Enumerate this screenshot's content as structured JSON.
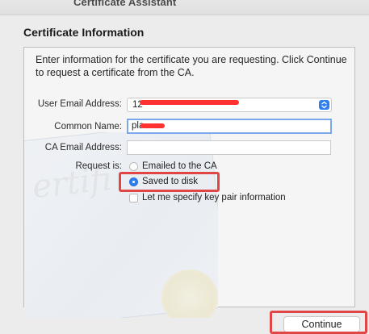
{
  "window": {
    "title": "Certificate Assistant"
  },
  "section": {
    "title": "Certificate Information"
  },
  "intro_text": "Enter information for the certificate you are requesting. Click Continue to request a certificate from the CA.",
  "form": {
    "user_email": {
      "label": "User Email Address:",
      "value": "12"
    },
    "common_name": {
      "label": "Common Name:",
      "value": "pla"
    },
    "ca_email": {
      "label": "CA Email Address:",
      "value": ""
    },
    "request_is": {
      "label": "Request is:",
      "options": [
        {
          "label": "Emailed to the CA",
          "selected": false
        },
        {
          "label": "Saved to disk",
          "selected": true
        }
      ]
    },
    "key_pair": {
      "label": "Let me specify key pair information",
      "checked": false
    }
  },
  "buttons": {
    "continue": "Continue"
  },
  "colors": {
    "accent": "#2d7ff2",
    "highlight": "#e04646",
    "redaction": "#ff3131"
  }
}
